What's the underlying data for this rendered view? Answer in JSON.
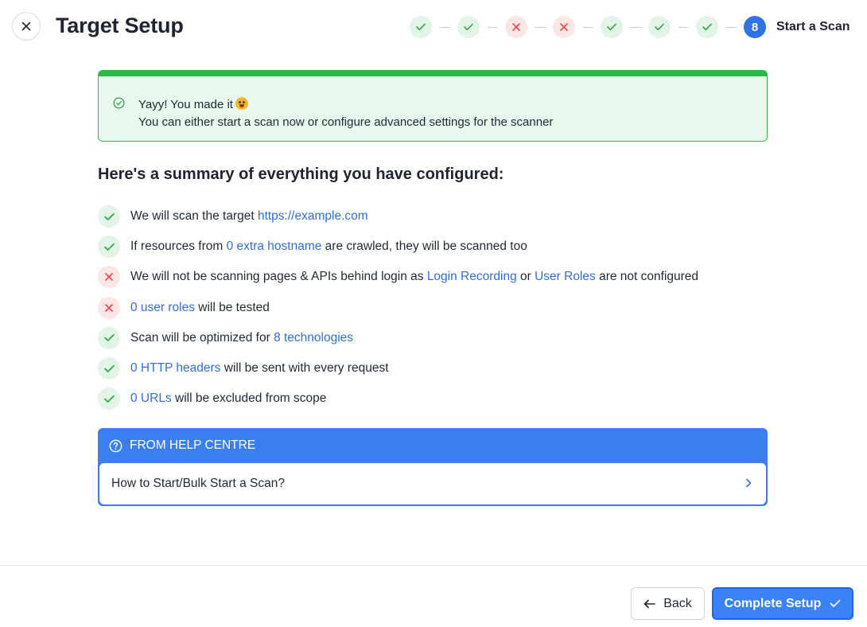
{
  "header": {
    "title": "Target Setup",
    "close_icon": "close-icon"
  },
  "stepper": {
    "steps": [
      {
        "status": "done",
        "icon": "check-icon"
      },
      {
        "status": "done",
        "icon": "check-icon"
      },
      {
        "status": "error",
        "icon": "x-icon"
      },
      {
        "status": "error",
        "icon": "x-icon"
      },
      {
        "status": "done",
        "icon": "check-icon"
      },
      {
        "status": "done",
        "icon": "check-icon"
      },
      {
        "status": "done",
        "icon": "check-icon"
      }
    ],
    "current_number": "8",
    "current_label": "Start a Scan"
  },
  "success": {
    "title": "Yayy! You made it",
    "emoji": "grinning-face-emoji",
    "subtitle": "You can either start a scan now or configure advanced settings for the scanner"
  },
  "summary": {
    "title": "Here's a summary of everything you have configured:",
    "items": [
      {
        "status": "ok",
        "pre": "We will scan the target ",
        "link1": "https://example.com",
        "mid": "",
        "link2": "",
        "post": ""
      },
      {
        "status": "ok",
        "pre": "If resources from ",
        "link1": "0 extra hostname",
        "mid": " are crawled, they will be scanned too",
        "link2": "",
        "post": ""
      },
      {
        "status": "err",
        "pre": "We will not be scanning pages & APIs behind login as ",
        "link1": "Login Recording",
        "mid": " or ",
        "link2": "User Roles",
        "post": " are not configured"
      },
      {
        "status": "err",
        "pre": "",
        "link1": "0 user roles",
        "mid": " will be tested",
        "link2": "",
        "post": ""
      },
      {
        "status": "ok",
        "pre": "Scan will be optimized for ",
        "link1": "8 technologies",
        "mid": "",
        "link2": "",
        "post": ""
      },
      {
        "status": "ok",
        "pre": "",
        "link1": "0 HTTP headers",
        "mid": " will be sent with every request",
        "link2": "",
        "post": ""
      },
      {
        "status": "ok",
        "pre": "",
        "link1": "0 URLs",
        "mid": " will be excluded from scope",
        "link2": "",
        "post": ""
      }
    ]
  },
  "help": {
    "header": "FROM HELP CENTRE",
    "item": "How to Start/Bulk Start a Scan?"
  },
  "footer": {
    "back_label": "Back",
    "complete_label": "Complete Setup"
  },
  "colors": {
    "primary": "#3b82f6",
    "success": "#2fb84a",
    "error": "#e5484d",
    "link": "#2f6fdb"
  }
}
